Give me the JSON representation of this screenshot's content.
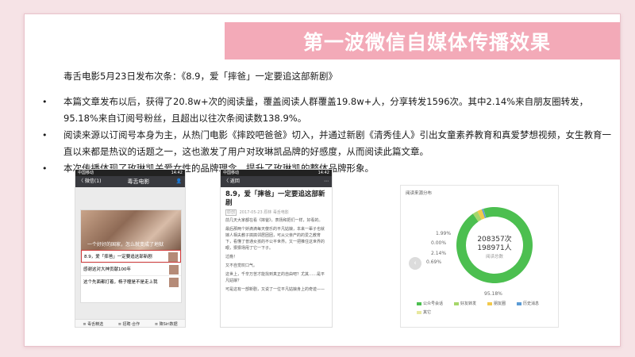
{
  "title": "第一波微信自媒体传播效果",
  "lead": "毒舌电影5月23日发布次条：《8.9，爱「摔爸」一定要追这部新剧》",
  "bullets": [
    "本篇文章发布以后，获得了20.8w+次的阅读量，覆盖阅读人群覆盖19.8w+人，分享转发1596次。其中2.14%来自朋友圈转发，95.18%来自订阅号粉丝，且超出以往次条阅读数138.9%。",
    "阅读来源以订阅号本身为主，从热门电影《摔跤吧爸爸》切入，并通过新剧《清秀佳人》引出女童素养教育和真爱梦想视频，女生教育一直以来都是热议的话题之一，这也激发了用户对玫琳凯品牌的好感度，从而阅读此篇文章。",
    "本次传播体现了玫琳凯关爱女性的品牌理念，提升了玫琳凯的整体品牌形象。"
  ],
  "phone1": {
    "carrier": "中国移动",
    "time": "14:42",
    "back": "〈 微信(1)",
    "account": "毒舌电影",
    "feed_caption": "一个好好的国家，怎么就变成了地狱",
    "rows": [
      "8.9，爱「摔爸」一定要追这部新剧",
      "感谢这对大神贡献100年",
      "这个先面都打着，杨子瞳是不是走上我"
    ],
    "tabs": [
      "≡ 毒舌精选",
      "≡ 招聘·合作",
      "≡ 降Siri数据"
    ]
  },
  "phone2": {
    "carrier": "中国移动",
    "time": "14:42",
    "back": "〈 返回",
    "article_title": "8.9，爱「摔爸」一定要追这部新剧",
    "meta_tag": "原创",
    "meta_date": "2017-05-23",
    "meta_author": "原林",
    "meta_account": "毒舌电影",
    "paras": [
      "前几天大家都在看《摔爸》，表扬和把们一样，好看的。",
      "最后那两个娇滴滴每天傻乐的平凡姑娘，本来一辈子也就嫁人相夫教子搞搞邻居团团，可从父亲产的的爱之教育下，看懂了普通女孩的不公平世界。又一把推住这世界的眼，狠狠场甩了它一下子。",
      "过瘾！",
      "又不自觉叹口气。",
      "这世上，千辛万苦才能找到真正的自由吧？尤其……是平凡姑娘？",
      "可是这有一部新剧，又说了一位平凡姑娘身上的奇迹——"
    ]
  },
  "chart_data": {
    "type": "pie",
    "title": "阅读来源分布",
    "center_value_1": "208357次",
    "center_value_2": "198971人",
    "center_label": "阅读总数",
    "slices": [
      {
        "name": "公众号会话",
        "value": 95.18,
        "label": "95.18%",
        "color": "#4cbf50"
      },
      {
        "name": "好友转发",
        "value": 2.14,
        "label": "2.14%",
        "color": "#a6d66a"
      },
      {
        "name": "朋友圈",
        "value": 1.99,
        "label": "1.99%",
        "color": "#f2c94c"
      },
      {
        "name": "历史消息",
        "value": 0.69,
        "label": "0.69%",
        "color": "#5b9bd5"
      },
      {
        "name": "其它",
        "value": 0.0,
        "label": "0.00%",
        "color": "#e8e8a0"
      }
    ]
  }
}
